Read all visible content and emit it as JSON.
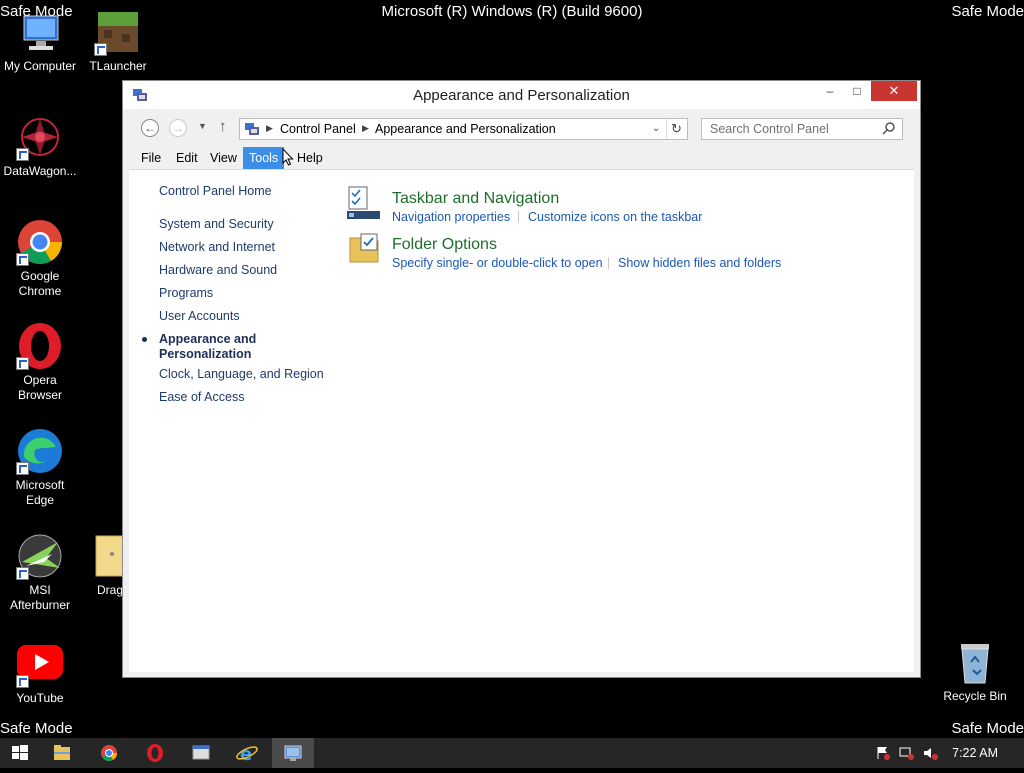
{
  "desktop": {
    "safe_mode": "Safe Mode",
    "build_title": "Microsoft (R) Windows (R) (Build 9600)",
    "icons": {
      "my_computer": "My Computer",
      "tlauncher": "TLauncher",
      "datawagon": "DataWagon...",
      "chrome": "Google Chrome",
      "opera": "Opera Browser",
      "edge": "Microsoft Edge",
      "msi": "MSI Afterburner",
      "drag_center": "Drag Cent",
      "youtube": "YouTube",
      "recycle_bin": "Recycle Bin"
    }
  },
  "window": {
    "title": "Appearance and Personalization",
    "controls": {
      "minimize": "–",
      "maximize": "□",
      "close": "✕"
    },
    "address": {
      "crumbs": [
        "Control Panel",
        "Appearance and Personalization"
      ]
    },
    "search": {
      "placeholder": "Search Control Panel"
    },
    "menu": [
      "File",
      "Edit",
      "View",
      "Tools",
      "Help"
    ],
    "active_menu": "Tools",
    "sidebar": {
      "home": "Control Panel Home",
      "items": [
        "System and Security",
        "Network and Internet",
        "Hardware and Sound",
        "Programs",
        "User Accounts",
        "Appearance and Personalization",
        "Clock, Language, and Region",
        "Ease of Access"
      ],
      "current_line1": "Appearance and",
      "current_line2": "Personalization"
    },
    "categories": [
      {
        "title": "Taskbar and Navigation",
        "icon": "taskbar-icon",
        "links": [
          "Navigation properties",
          "Customize icons on the taskbar"
        ]
      },
      {
        "title": "Folder Options",
        "icon": "folder-options-icon",
        "links": [
          "Specify single- or double-click to open",
          "Show hidden files and folders"
        ]
      }
    ]
  },
  "taskbar": {
    "clock": "7:22 AM",
    "apps": [
      "start-icon",
      "file-explorer-icon",
      "chrome-icon",
      "opera-icon",
      "window-icon",
      "internet-explorer-icon",
      "control-panel-icon"
    ]
  },
  "colors": {
    "desktop_bg": "#000000",
    "accent": "#3d8ee6",
    "link": "#1c57b5",
    "category_title": "#1e6e2a",
    "close_red": "#c7372f"
  }
}
